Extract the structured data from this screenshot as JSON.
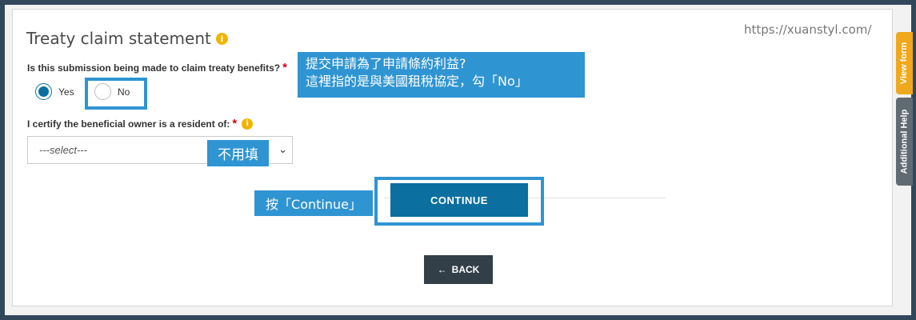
{
  "watermark": "https://xuanstyl.com/",
  "form": {
    "title": "Treaty claim statement",
    "info_icon": "i",
    "question": "Is this submission being made to claim treaty benefits?",
    "required_mark": "*",
    "options": [
      {
        "label": "Yes",
        "selected": true
      },
      {
        "label": "No",
        "selected": false
      }
    ],
    "certify_label": "I certify the beneficial owner is a resident of:",
    "select_value": "---select---",
    "chevron": "⌄",
    "continue_label": "CONTINUE",
    "back_icon": "←",
    "back_label": "BACK"
  },
  "annotations": {
    "main_line1": "提交申請為了申請條約利益?",
    "main_line2": "這裡指的是與美國租稅協定，勾「No」",
    "fill_note": "不用填",
    "continue_note": "按「Continue」"
  },
  "side_tabs": {
    "view_form": "View form",
    "help": "Additional Help"
  },
  "colors": {
    "primary": "#0b6fa0",
    "annotation": "#2f94d2",
    "warning": "#f0b400",
    "required": "#d0021b"
  }
}
